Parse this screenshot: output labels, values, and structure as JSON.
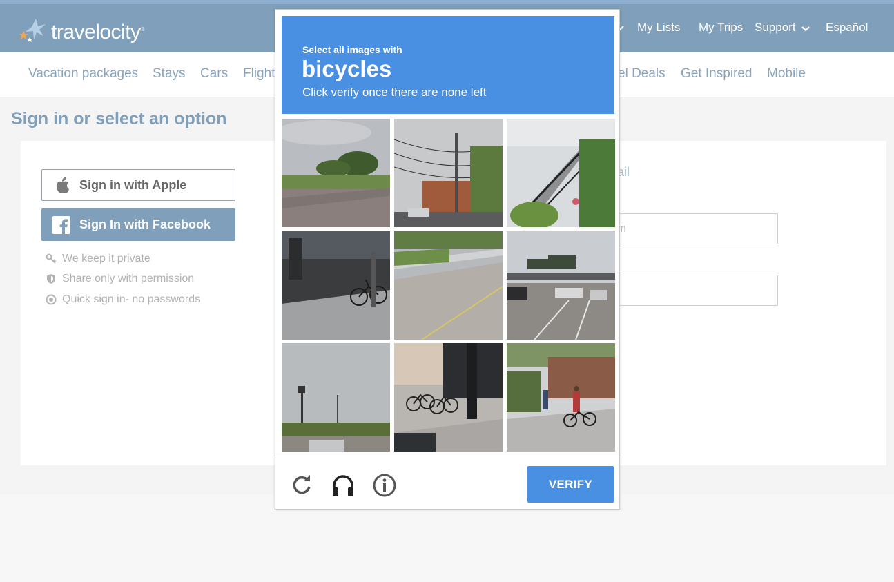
{
  "brand": {
    "name": "travelocity",
    "mark": "®"
  },
  "topnav": {
    "my_lists": "My Lists",
    "my_trips": "My Trips",
    "support": "Support",
    "language": "Español"
  },
  "subnav": [
    "Vacation packages",
    "Stays",
    "Cars",
    "Flight",
    "el Deals",
    "Get Inspired",
    "Mobile"
  ],
  "page": {
    "title": "Sign in or select an option"
  },
  "signin": {
    "apple_label": "Sign in with Apple",
    "facebook_label": "Sign In with Facebook",
    "perks": [
      "We keep it private",
      "Share only with permission",
      "Quick sign in- no passwords"
    ]
  },
  "form_fragments": {
    "heading_tail": "ail",
    "email_tail": "m"
  },
  "captcha": {
    "instruction": "Select all images with",
    "target": "bicycles",
    "subtext": "Click verify once there are none left",
    "verify_label": "VERIFY",
    "tiles": [
      "park-lawn",
      "street-poles",
      "house-stairs",
      "bike-rack-garage",
      "highway-overpass",
      "freeway",
      "grass-road",
      "bicycles-parked",
      "cyclist-sidewalk"
    ]
  },
  "colors": {
    "header": "#7f9fba",
    "accent": "#4a90e2",
    "link": "#8aa4be"
  }
}
